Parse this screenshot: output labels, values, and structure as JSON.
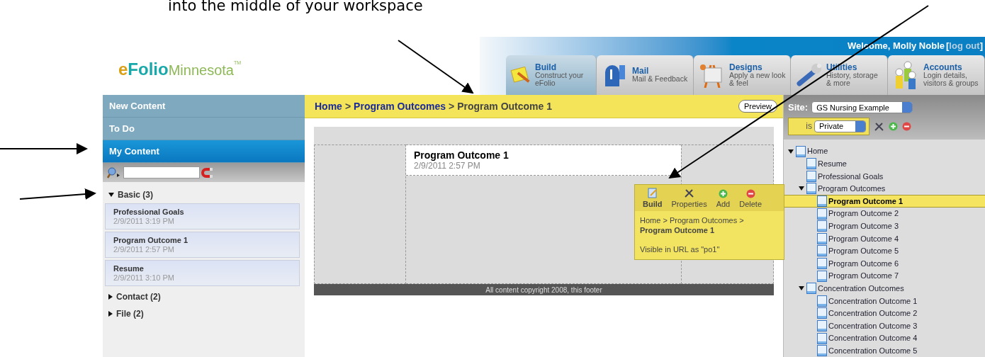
{
  "caption": "into the middle of your workspace",
  "logo": {
    "part_1": "e",
    "part_2": "Folio",
    "part_3": "Minnesota",
    "mark": "TM"
  },
  "header": {
    "welcome": "Welcome, Molly Noble",
    "bracket_open": "[",
    "logout": "log out",
    "bracket_close": "]"
  },
  "tabs": [
    {
      "kind": "build",
      "label": "Build",
      "description": "Construct your eFolio",
      "selected": true
    },
    {
      "kind": "mail",
      "label": "Mail",
      "description": "Mail & Feedback",
      "selected": false
    },
    {
      "kind": "designs",
      "label": "Designs",
      "description": "Apply a new look & feel",
      "selected": false
    },
    {
      "kind": "utilities",
      "label": "Utilities",
      "description": "History, storage & more",
      "selected": false
    },
    {
      "kind": "accounts",
      "label": "Accounts",
      "description": "Login details, visitors & groups",
      "selected": false
    }
  ],
  "sidebar": {
    "nav": [
      {
        "label": "New Content",
        "selected": false
      },
      {
        "label": "To Do",
        "selected": false
      },
      {
        "label": "My Content",
        "selected": true
      }
    ],
    "groups": [
      {
        "label": "Basic (3)",
        "expanded": true,
        "items": [
          {
            "title": "Professional Goals",
            "date": "2/9/2011 3:19 PM"
          },
          {
            "title": "Program Outcome 1",
            "date": "2/9/2011 2:57 PM"
          },
          {
            "title": "Resume",
            "date": "2/9/2011 3:10 PM"
          }
        ]
      },
      {
        "label": "Contact (2)",
        "expanded": false
      },
      {
        "label": "File (2)",
        "expanded": false
      }
    ]
  },
  "breadcrumb": {
    "links": [
      {
        "label": "Home",
        "separator": ">"
      },
      {
        "label": "Program Outcomes",
        "separator": ">"
      }
    ],
    "current": "Program Outcome 1",
    "preview_button": "Preview"
  },
  "page": {
    "title": "Program Outcome 1",
    "date": "2/9/2011 2:57 PM",
    "footer": "All content copyright 2008, this footer"
  },
  "popup": {
    "actions": [
      {
        "kind": "build",
        "label": "Build",
        "selected": true
      },
      {
        "kind": "properties",
        "label": "Properties",
        "selected": false
      },
      {
        "kind": "add",
        "label": "Add",
        "selected": false
      },
      {
        "kind": "delete",
        "label": "Delete",
        "selected": false
      }
    ],
    "path": "Home > Program Outcomes >",
    "title": "Program Outcome 1",
    "url_note": "Visible in URL as \"po1\""
  },
  "site_panel": {
    "site_label": "Site:",
    "site": "GS Nursing Example",
    "is_label": "is",
    "visibility": "Private"
  },
  "tree": [
    {
      "label": "Home",
      "selected": false,
      "expanded": true,
      "children": [
        {
          "label": "Resume",
          "selected": false
        },
        {
          "label": "Professional Goals",
          "selected": false
        },
        {
          "label": "Program Outcomes",
          "selected": false,
          "expanded": true,
          "children": [
            {
              "label": "Program Outcome 1",
              "selected": true
            },
            {
              "label": "Program Outcome 2",
              "selected": false
            },
            {
              "label": "Program Outcome 3",
              "selected": false
            },
            {
              "label": "Program Outcome 4",
              "selected": false
            },
            {
              "label": "Program Outcome 5",
              "selected": false
            },
            {
              "label": "Program Outcome 6",
              "selected": false
            },
            {
              "label": "Program Outcome 7",
              "selected": false
            }
          ]
        },
        {
          "label": "Concentration Outcomes",
          "selected": false,
          "expanded": true,
          "children": [
            {
              "label": "Concentration Outcome 1",
              "selected": false
            },
            {
              "label": "Concentration Outcome 2",
              "selected": false
            },
            {
              "label": "Concentration Outcome 3",
              "selected": false
            },
            {
              "label": "Concentration Outcome 4",
              "selected": false
            },
            {
              "label": "Concentration Outcome 5",
              "selected": false
            }
          ]
        }
      ]
    }
  ]
}
